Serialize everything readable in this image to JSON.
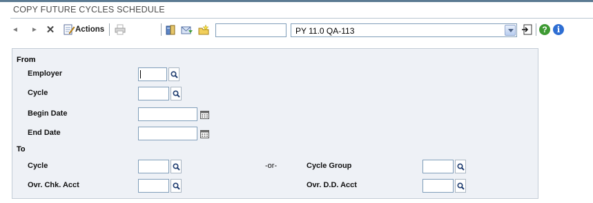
{
  "window": {
    "title": "COPY FUTURE CYCLES SCHEDULE"
  },
  "toolbar": {
    "actions_label": "Actions",
    "search_value": "",
    "environment": "PY 11.0 QA-113",
    "help_glyph": "?",
    "info_glyph": "i"
  },
  "form": {
    "from": {
      "heading": "From",
      "employer": {
        "label": "Employer",
        "value": ""
      },
      "cycle": {
        "label": "Cycle",
        "value": ""
      },
      "begin_date": {
        "label": "Begin Date",
        "value": ""
      },
      "end_date": {
        "label": "End Date",
        "value": ""
      }
    },
    "to": {
      "heading": "To",
      "cycle": {
        "label": "Cycle",
        "value": ""
      },
      "or_text": "-or-",
      "cycle_group": {
        "label": "Cycle Group",
        "value": ""
      },
      "ovr_chk_acct": {
        "label": "Ovr. Chk. Acct",
        "value": ""
      },
      "ovr_dd_acct": {
        "label": "Ovr. D.D. Acct",
        "value": ""
      }
    }
  },
  "colors": {
    "title_bar_border": "#5b7a92",
    "panel_bg": "#eef1f6",
    "field_border": "#7f9db9"
  }
}
